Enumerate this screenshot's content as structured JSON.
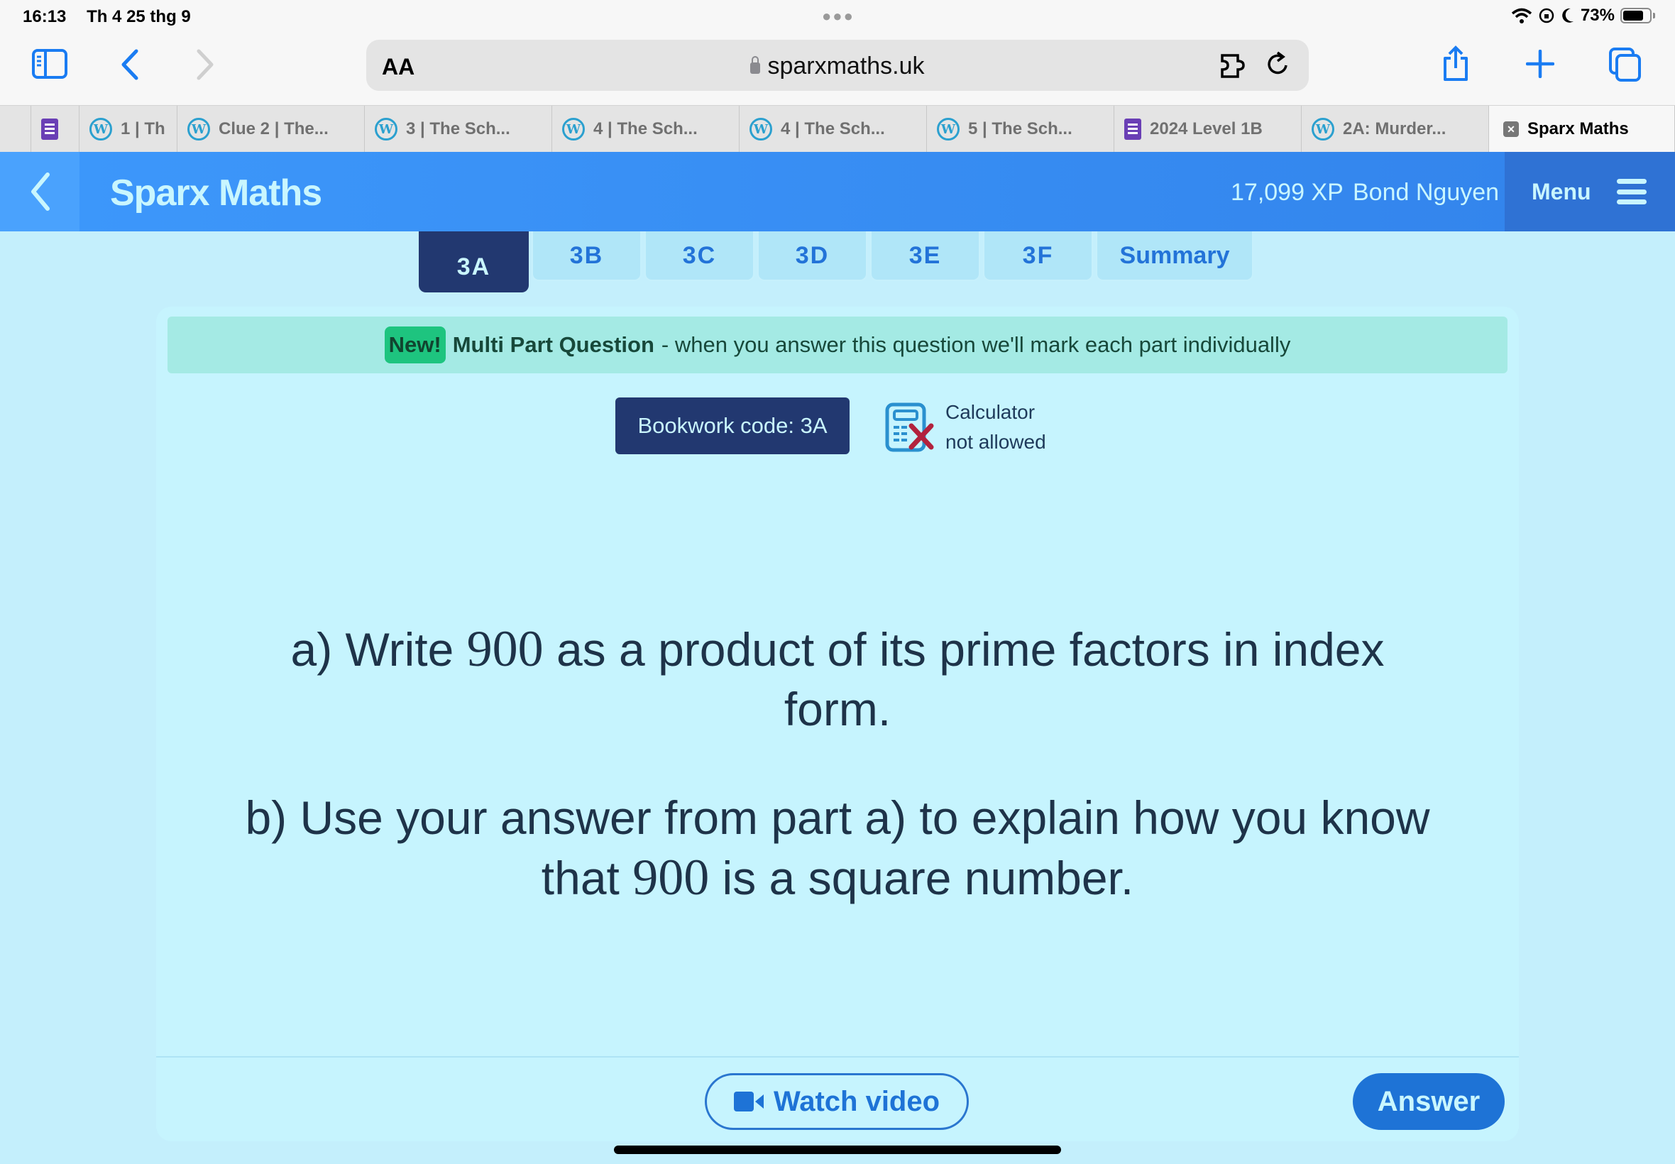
{
  "status_bar": {
    "time": "16:13",
    "date": "Th 4 25 thg 9",
    "battery_percent": "73%",
    "icons": [
      "wifi-icon",
      "orientation-lock-icon",
      "moon-icon",
      "battery-icon"
    ]
  },
  "browser": {
    "url": "sparxmaths.uk",
    "aa_label": "AA",
    "icons": [
      "sidebar-icon",
      "back-icon",
      "forward-icon",
      "lock-icon",
      "extension-icon",
      "reload-icon",
      "share-icon",
      "new-tab-icon",
      "tabs-overview-icon"
    ]
  },
  "tabs": [
    {
      "label": "",
      "icon": "none"
    },
    {
      "label": "",
      "icon": "forms-icon"
    },
    {
      "label": "1 | Th",
      "icon": "wordpress-icon"
    },
    {
      "label": "Clue 2 | The...",
      "icon": "wordpress-icon"
    },
    {
      "label": "3 | The Sch...",
      "icon": "wordpress-icon"
    },
    {
      "label": "4 | The Sch...",
      "icon": "wordpress-icon"
    },
    {
      "label": "4 | The Sch...",
      "icon": "wordpress-icon"
    },
    {
      "label": "5 | The Sch...",
      "icon": "wordpress-icon"
    },
    {
      "label": "2024 Level 1B",
      "icon": "forms-icon"
    },
    {
      "label": "2A: Murder...",
      "icon": "wordpress-icon"
    },
    {
      "label": "Sparx Maths",
      "icon": "close-icon",
      "active": true
    }
  ],
  "app": {
    "brand": "Sparx Maths",
    "xp": "17,099 XP",
    "user": "Bond Nguyen",
    "menu_label": "Menu",
    "colors": {
      "header": "#3d98fb",
      "accent": "#1e73d6",
      "dark": "#223870"
    }
  },
  "question_tabs": [
    {
      "label": "3A",
      "active": true
    },
    {
      "label": "3B"
    },
    {
      "label": "3C"
    },
    {
      "label": "3D"
    },
    {
      "label": "3E"
    },
    {
      "label": "3F"
    },
    {
      "label": "Summary"
    }
  ],
  "banner": {
    "badge": "New!",
    "title": "Multi Part Question",
    "text": "- when you answer this question we'll mark each part individually"
  },
  "bookwork": {
    "label": "Bookwork code: 3A"
  },
  "calculator": {
    "line1": "Calculator",
    "line2": "not allowed"
  },
  "question": {
    "part_a": {
      "prefix": "a) Write ",
      "number": "900",
      "suffix": " as a product of its prime factors in index form."
    },
    "part_b": {
      "prefix": "b) Use your answer from part a) to explain how you know that ",
      "number": "900",
      "suffix": " is a square number."
    }
  },
  "actions": {
    "watch_video": "Watch video",
    "answer": "Answer"
  }
}
